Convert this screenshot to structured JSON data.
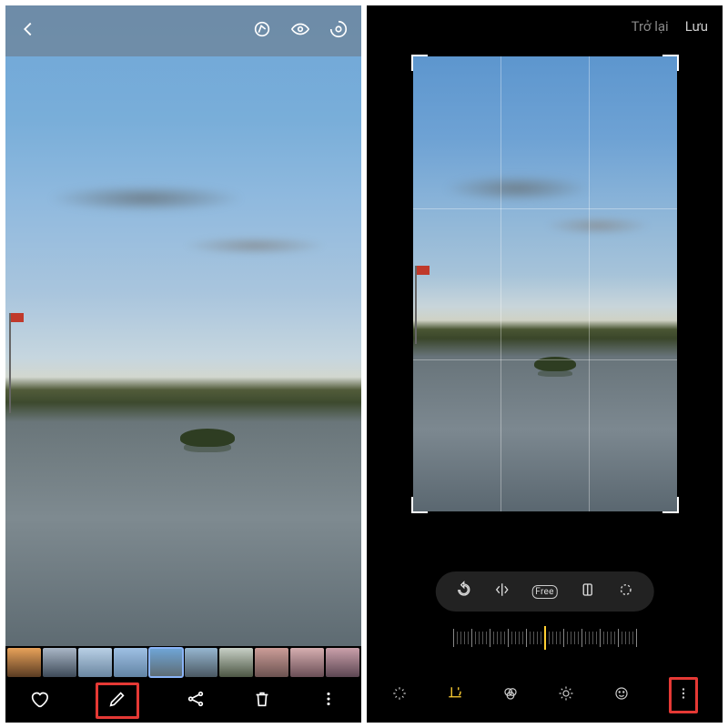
{
  "left": {
    "header_icons": [
      "back",
      "bixby-vision",
      "show-hide",
      "cast"
    ],
    "thumbs": [
      {
        "id": "t1",
        "bg": "linear-gradient(#e8a25a,#5a3b22)"
      },
      {
        "id": "t2",
        "bg": "linear-gradient(#a9b6c6,#3e4a58)"
      },
      {
        "id": "t3",
        "bg": "linear-gradient(#b9d0e6,#6a86a0)"
      },
      {
        "id": "t4",
        "bg": "linear-gradient(#9fc0e4,#6284a4)"
      },
      {
        "id": "t5",
        "bg": "linear-gradient(#6fa6d8,#5e6b72)",
        "selected": true
      },
      {
        "id": "t6",
        "bg": "linear-gradient(#96b6d0,#4a5862)"
      },
      {
        "id": "t7",
        "bg": "linear-gradient(#c8d0c6,#4c5644)"
      },
      {
        "id": "t8",
        "bg": "linear-gradient(#cc9d98,#6b5250)"
      },
      {
        "id": "t9",
        "bg": "linear-gradient(#d6aeb0,#6a4e56)"
      },
      {
        "id": "t10",
        "bg": "linear-gradient(#caa0aa,#5c4652)"
      }
    ],
    "footer_icons": [
      {
        "name": "favorite",
        "highlighted": false
      },
      {
        "name": "edit",
        "highlighted": true
      },
      {
        "name": "share",
        "highlighted": false
      },
      {
        "name": "delete",
        "highlighted": false
      },
      {
        "name": "more",
        "highlighted": false
      }
    ]
  },
  "right": {
    "header": {
      "back_label": "Trở lại",
      "save_label": "Lưu"
    },
    "transform_tools": [
      "rotate",
      "flip",
      "ratio-free",
      "crop-shape",
      "lasso"
    ],
    "ratio_free_label": "Free",
    "tabs": [
      {
        "name": "auto",
        "active": false
      },
      {
        "name": "crop-rotate",
        "active": true
      },
      {
        "name": "filters",
        "active": false
      },
      {
        "name": "adjust",
        "active": false
      },
      {
        "name": "stickers",
        "active": false
      },
      {
        "name": "more",
        "active": false,
        "highlighted": true
      }
    ],
    "angle_value": 0
  }
}
